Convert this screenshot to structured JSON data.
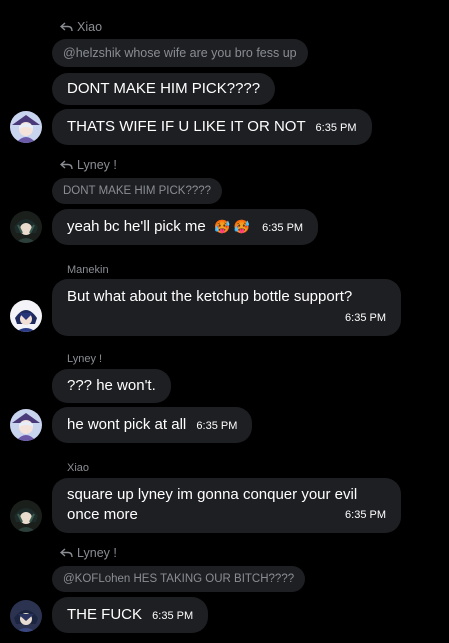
{
  "colors": {
    "background": "#000000",
    "bubble": "#1e1f23",
    "muted_text": "#8a8d93",
    "text": "#ffffff"
  },
  "messages": [
    {
      "reply_to": "Xiao",
      "quoted": "@helzshik whose wife are you bro fess up"
    },
    {
      "text": "DONT MAKE HIM PICK????"
    },
    {
      "text": "THATS WIFE IF U LIKE IT OR NOT",
      "time": "6:35 PM"
    },
    {
      "reply_to": "Lyney !",
      "quoted": "DONT MAKE HIM PICK????"
    },
    {
      "text": "yeah bc he'll pick me",
      "emoji": "🥵 🥵",
      "time": "6:35 PM"
    },
    {
      "sender": "Manekin",
      "text": "But what about the ketchup bottle support?",
      "time": "6:35 PM"
    },
    {
      "sender": "Lyney !",
      "text": "??? he won't."
    },
    {
      "text": "he wont pick at all",
      "time": "6:35 PM"
    },
    {
      "sender": "Xiao",
      "text_line1": "square up lyney im gonna conquer your evil",
      "text_line2": "once more",
      "time": "6:35 PM"
    },
    {
      "reply_to": "Lyney !",
      "quoted": "@KOFLohen HES TAKING OUR BITCH????"
    },
    {
      "text": "THE FUCK",
      "time": "6:35 PM"
    }
  ],
  "icons": {
    "reply": "reply-arrow-icon",
    "avatars": [
      "avatar-purple-hat",
      "avatar-dark-hair-green",
      "avatar-blue-hair",
      "avatar-purple-hat",
      "avatar-dark-hair-green",
      "avatar-dark-blue-hair"
    ]
  }
}
